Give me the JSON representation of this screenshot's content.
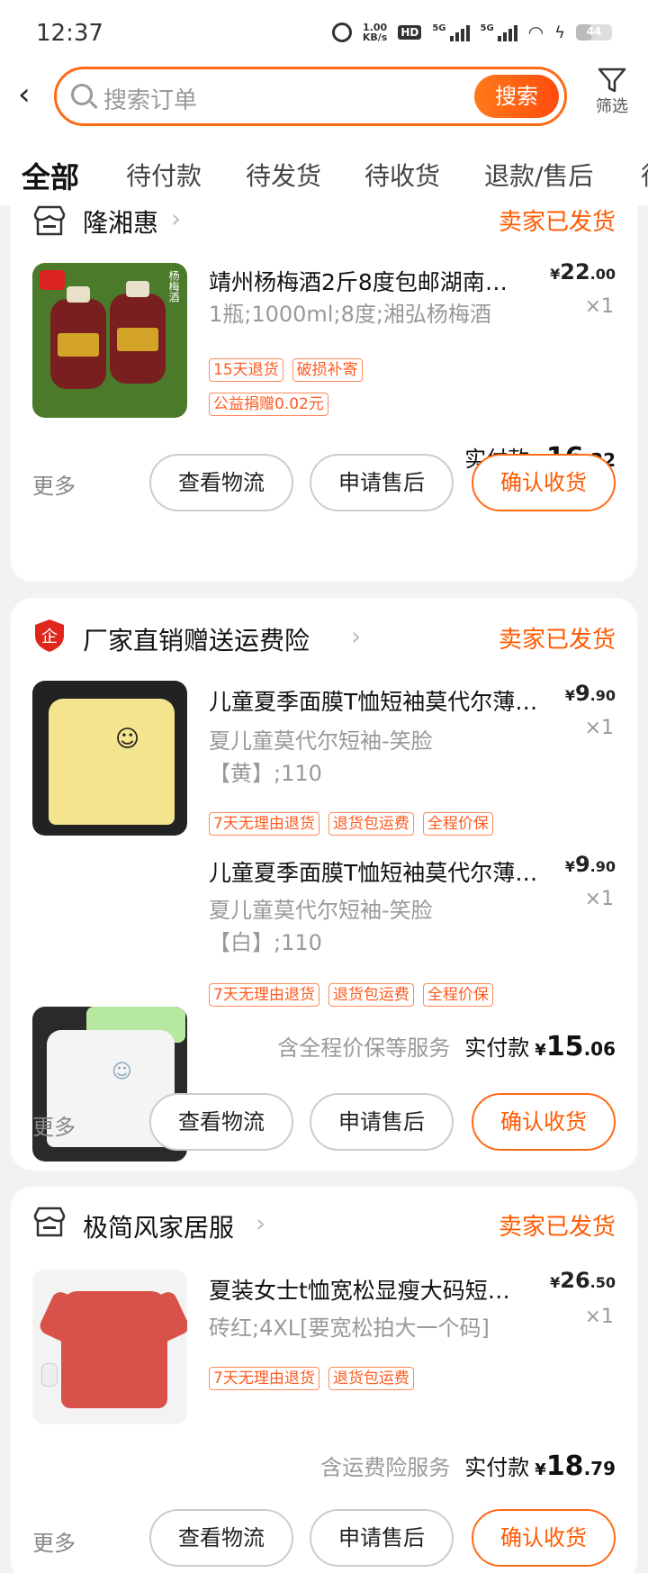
{
  "status_bar": {
    "time": "12:37",
    "speed_value": "1.00",
    "speed_unit": "KB/s",
    "hd": "HD",
    "sig1": "5G",
    "sig2": "5G",
    "battery": "44"
  },
  "search": {
    "placeholder": "搜索订单",
    "button": "搜索",
    "filter_label": "筛选"
  },
  "tabs": [
    "全部",
    "待付款",
    "待发货",
    "待收货",
    "退款/售后",
    "待"
  ],
  "orders": [
    {
      "shop": "隆湘惠",
      "status": "卖家已发货",
      "items": [
        {
          "title": "靖州杨梅酒2斤8度包邮湖南…",
          "spec": "1瓶;1000ml;8度;湘弘杨梅酒",
          "price_int": "22",
          "price_dec": ".00",
          "qty": "×1",
          "tags": [
            "15天退货",
            "破损补寄",
            "公益捐赠0.02元"
          ],
          "image": "杨梅酒"
        }
      ],
      "service_note": "",
      "total_label": "实付款",
      "total_int": "16",
      "total_dec": ".22",
      "more": "更多",
      "btn1": "查看物流",
      "btn2": "申请售后",
      "btn3": "确认收货"
    },
    {
      "shop": "厂家直销赠送运费险",
      "status": "卖家已发货",
      "items": [
        {
          "title": "儿童夏季面膜T恤短袖莫代尔薄…",
          "spec1": "夏儿童莫代尔短袖-笑脸",
          "spec2": "【黄】;110",
          "price_int": "9",
          "price_dec": ".90",
          "qty": "×1",
          "tags": [
            "7天无理由退货",
            "退货包运费",
            "全程价保"
          ]
        },
        {
          "title": "儿童夏季面膜T恤短袖莫代尔薄…",
          "spec1": "夏儿童莫代尔短袖-笑脸",
          "spec2": "【白】;110",
          "price_int": "9",
          "price_dec": ".90",
          "qty": "×1",
          "tags": [
            "7天无理由退货",
            "退货包运费",
            "全程价保"
          ]
        }
      ],
      "service_note": "含全程价保等服务",
      "total_label": "实付款",
      "total_int": "15",
      "total_dec": ".06",
      "more": "更多",
      "btn1": "查看物流",
      "btn2": "申请售后",
      "btn3": "确认收货"
    },
    {
      "shop": "极简风家居服",
      "status": "卖家已发货",
      "items": [
        {
          "title": "夏装女士t恤宽松显瘦大码短…",
          "spec": "砖红;4XL[要宽松拍大一个码]",
          "price_int": "26",
          "price_dec": ".50",
          "qty": "×1",
          "tags": [
            "7天无理由退货",
            "退货包运费"
          ]
        }
      ],
      "service_note": "含运费险服务",
      "total_label": "实付款",
      "total_int": "18",
      "total_dec": ".79",
      "more": "更多",
      "btn1": "查看物流",
      "btn2": "申请售后",
      "btn3": "确认收货"
    }
  ],
  "currency": "¥",
  "colors": {
    "accent": "#ff5a00",
    "tag_border": "#ff8a5a"
  }
}
